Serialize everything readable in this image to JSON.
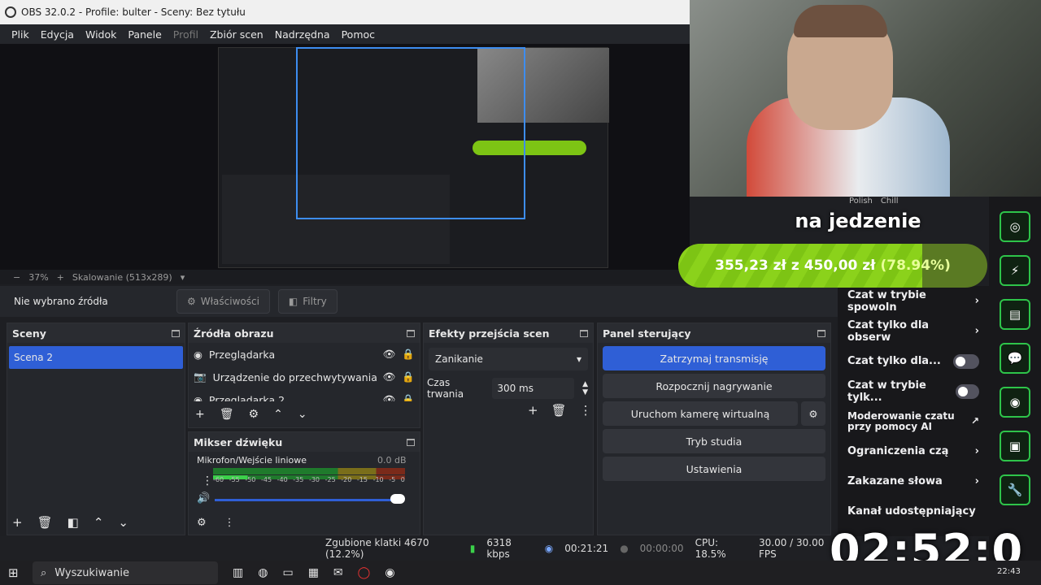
{
  "window": {
    "title": "OBS 32.0.2 - Profile: bulter - Sceny: Bez tytułu"
  },
  "menu": [
    "Plik",
    "Edycja",
    "Widok",
    "Panele",
    "Profil",
    "Zbiór scen",
    "Nadrzędna",
    "Pomoc"
  ],
  "zoom": {
    "percent": "37%",
    "scaling": "Skalowanie (513x289)",
    "minus": "−",
    "plus": "+"
  },
  "source_toolbar": {
    "no_source": "Nie wybrano źródła",
    "properties": "Właściwości",
    "filters": "Filtry"
  },
  "scenes": {
    "title": "Sceny",
    "items": [
      "Scena 2"
    ]
  },
  "sources": {
    "title": "Źródła obrazu",
    "items": [
      "Przeglądarka",
      "Urządzenie do przechwytywania v",
      "Przeglądarka 2"
    ]
  },
  "mixer": {
    "title": "Mikser dźwięku",
    "channel": "Mikrofon/Wejście liniowe",
    "db": "0.0 dB",
    "ticks": [
      "-60",
      "-55",
      "-50",
      "-45",
      "-40",
      "-35",
      "-30",
      "-25",
      "-20",
      "-15",
      "-10",
      "-5",
      "0"
    ]
  },
  "transitions": {
    "title": "Efekty przejścia scen",
    "selected": "Zanikanie",
    "duration_label": "Czas trwania",
    "duration_value": "300 ms"
  },
  "controls": {
    "title": "Panel sterujący",
    "stop_stream": "Zatrzymaj transmisję",
    "start_record": "Rozpocznij nagrywanie",
    "virtual_cam": "Uruchom kamerę wirtualną",
    "studio": "Tryb studia",
    "settings": "Ustawienia"
  },
  "status": {
    "dropped": "Zgubione klatki 4670 (12.2%)",
    "bitrate": "6318 kbps",
    "stream_time": "00:21:21",
    "rec_time": "00:00:00",
    "cpu": "CPU: 18.5%",
    "fps": "30.00 / 30.00 FPS"
  },
  "taskbar": {
    "search": "Wyszukiwanie",
    "clock": "22:43"
  },
  "overlay": {
    "goal_title": "na jedzenie",
    "goal_current": "355,23 zł",
    "goal_sep": "z",
    "goal_target": "450,00 zł",
    "goal_pct": "(78.94%)",
    "goal_fraction": 0.7894,
    "timer": "02:52:0",
    "chips": [
      "Polish",
      "Chill"
    ]
  },
  "chat_settings": [
    {
      "label": "Czat w trybie spowoln",
      "kind": "arrow"
    },
    {
      "label": "Czat tylko dla obserw",
      "kind": "arrow"
    },
    {
      "label": "Czat tylko dla...",
      "kind": "toggle"
    },
    {
      "label": "Czat w trybie tylk...",
      "kind": "toggle"
    },
    {
      "label": "Moderowanie czatu przy pomocy AI",
      "kind": "ext"
    },
    {
      "label": "Ograniczenia czą",
      "kind": "arrow"
    },
    {
      "label": "Zakazane słowa",
      "kind": "arrow"
    },
    {
      "label": "Kanał udostępniający",
      "kind": "none"
    }
  ],
  "icons": {
    "accent": "#2ec44a",
    "obs_blue": "#2f5fd6"
  }
}
